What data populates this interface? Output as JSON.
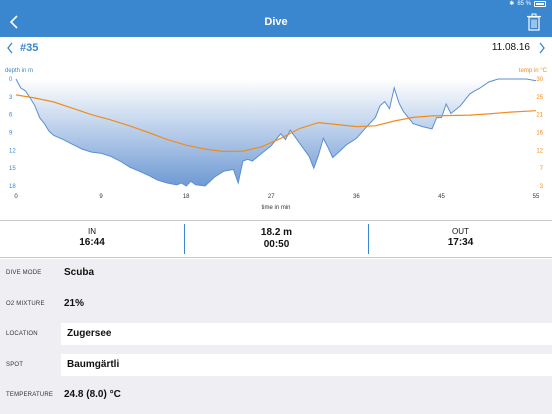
{
  "status_bar": {
    "battery_text": "85 %",
    "bluetooth_icon": "bluetooth-icon",
    "battery_icon": "battery-icon"
  },
  "nav": {
    "title": "Dive",
    "back_icon": "chevron-left-icon",
    "trash_icon": "trash-icon"
  },
  "dive": {
    "number": "#35",
    "date": "11.08.16",
    "prev_icon": "chevron-left-icon",
    "next_icon": "chevron-right-icon"
  },
  "colors": {
    "accent": "#3a86cf",
    "depth_fill": "#8fb4e0",
    "depth_line": "#5b8fd0",
    "temp_line": "#f08c1e"
  },
  "chart_data": {
    "type": "area",
    "xlabel": "time in min",
    "ylabel_left": "depth in m",
    "ylabel_right": "temp in °C",
    "x_ticks": [
      "0",
      "9",
      "18",
      "27",
      "36",
      "45",
      "55"
    ],
    "y_left_ticks": [
      "0",
      "3",
      "6",
      "9",
      "12",
      "15",
      "18"
    ],
    "y_right_ticks": [
      "30",
      "25",
      "21",
      "16",
      "12",
      "7",
      "3"
    ],
    "x_range": [
      0,
      55
    ],
    "y_left_range": [
      0,
      18
    ],
    "y_right_range": [
      3,
      30
    ],
    "grid": false,
    "series": [
      {
        "axis": "left",
        "x": [
          0,
          0.5,
          1,
          1.5,
          2,
          2.5,
          3,
          3.5,
          4,
          5,
          6,
          7,
          8,
          9,
          10,
          11,
          12,
          13,
          14,
          15,
          16,
          17,
          17.5,
          18,
          18.5,
          19,
          20,
          21,
          22,
          23,
          23.5,
          24,
          24.5,
          25,
          26,
          27,
          28,
          28.5,
          29,
          30,
          31,
          31.5,
          32,
          32.5,
          33,
          33.5,
          34,
          35,
          36,
          37,
          38,
          38.5,
          39,
          39.5,
          40,
          40.5,
          41,
          42,
          43,
          44,
          44.5,
          45,
          45.5,
          46,
          47,
          48,
          48.5,
          49,
          50,
          51,
          52,
          53,
          54,
          55
        ],
        "values": [
          0,
          1.5,
          2,
          3.2,
          4.5,
          6.5,
          7.5,
          8.8,
          9.5,
          10.2,
          11,
          11.8,
          12.3,
          12.5,
          13,
          13.8,
          14.8,
          15.5,
          16.2,
          17,
          17.5,
          17.8,
          17.5,
          18,
          17.2,
          17.8,
          18,
          16.5,
          15.5,
          15.2,
          17.5,
          13.8,
          13.5,
          13.8,
          12.5,
          11.2,
          9.2,
          10.2,
          8.6,
          10.8,
          13,
          15,
          12.8,
          10,
          11.5,
          13.2,
          12.5,
          11,
          10,
          8.2,
          6.5,
          4.5,
          3.8,
          5,
          1.5,
          4,
          5.5,
          7.5,
          8,
          8.4,
          6.5,
          6.5,
          4.2,
          5.8,
          4.5,
          2.5,
          2,
          1.6,
          0.5,
          0,
          0,
          0,
          0,
          0.3
        ]
      },
      {
        "axis": "right",
        "x": [
          0,
          2,
          4,
          6,
          8,
          10,
          12,
          14,
          16,
          18,
          20,
          22,
          24,
          26,
          28,
          30,
          32,
          34,
          36,
          38,
          40,
          42,
          44,
          46,
          48,
          50,
          52,
          55
        ],
        "values": [
          26,
          25.2,
          24.2,
          22.6,
          21,
          19.7,
          18.2,
          16.5,
          14.7,
          13.3,
          12.3,
          11.7,
          11.8,
          12.9,
          15,
          17.5,
          19,
          18.5,
          18,
          18.2,
          19.4,
          20.3,
          20.7,
          20.8,
          20.9,
          21.2,
          21.6,
          22
        ]
      }
    ]
  },
  "summary": {
    "in_label": "IN",
    "in_value": "16:44",
    "depth_value": "18.2 m",
    "duration_value": "00:50",
    "out_label": "OUT",
    "out_value": "17:34"
  },
  "details": {
    "dive_mode_label": "DIVE MODE",
    "dive_mode_value": "Scuba",
    "o2_label": "O2 MIXTURE",
    "o2_value": "21%",
    "location_label": "LOCATION",
    "location_value": "Zugersee",
    "spot_label": "SPOT",
    "spot_value": "Baumgärtli",
    "temperature_label": "TEMPERATURE",
    "temperature_value": "24.8 (8.0) °C"
  }
}
